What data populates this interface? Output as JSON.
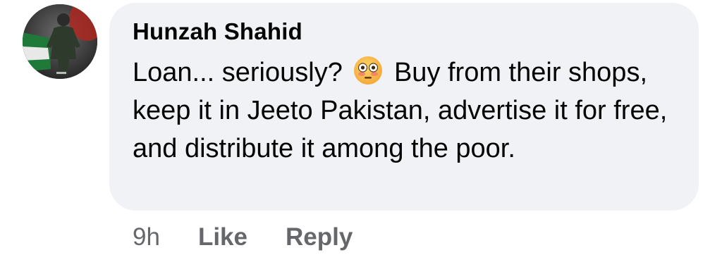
{
  "comment": {
    "author": "Hunzah Shahid",
    "text_before_emoji": "Loan... seriously? ",
    "emoji": "flushed-face-emoji",
    "text_after_emoji": " Buy from their shops, keep it in Jeeto Pakistan, advertise it for free, and distribute it among the poor.",
    "timestamp": "9h",
    "like_label": "Like",
    "reply_label": "Reply"
  },
  "colors": {
    "bubble_bg": "#f0f2f5",
    "text": "#050505",
    "meta": "#65676b"
  }
}
